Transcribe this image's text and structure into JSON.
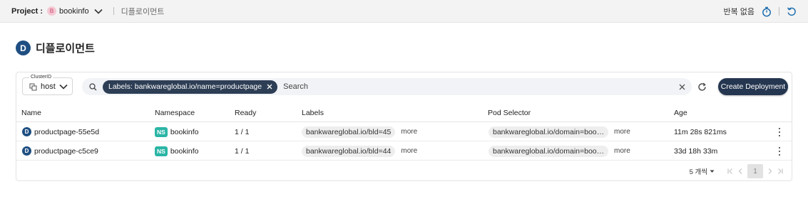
{
  "topbar": {
    "project_label": "Project :",
    "project_icon_letter": "B",
    "project_name": "bookinfo",
    "breadcrumb": "디플로이먼트",
    "repeat_label": "반복 없음"
  },
  "page": {
    "badge": "D",
    "title": "디플로이먼트"
  },
  "toolbar": {
    "cluster_label": "ClusterID",
    "cluster_value": "host",
    "filter_chip": "Labels: bankwareglobal.io/name=productpage",
    "search_placeholder": "Search",
    "create_label": "Create Deployment"
  },
  "table": {
    "columns": [
      "Name",
      "Namespace",
      "Ready",
      "Labels",
      "Pod Selector",
      "Age"
    ],
    "rows": [
      {
        "icon": "D",
        "name": "productpage-55e5d",
        "ns_badge": "NS",
        "namespace": "bookinfo",
        "ready": "1 / 1",
        "label": "bankwareglobal.io/bld=45",
        "label_more": "more",
        "selector": "bankwareglobal.io/domain=boo…",
        "selector_more": "more",
        "age": "11m 28s 821ms"
      },
      {
        "icon": "D",
        "name": "productpage-c5ce9",
        "ns_badge": "NS",
        "namespace": "bookinfo",
        "ready": "1 / 1",
        "label": "bankwareglobal.io/bld=44",
        "label_more": "more",
        "selector": "bankwareglobal.io/domain=boo…",
        "selector_more": "more",
        "age": "33d 18h 33m"
      }
    ]
  },
  "pagination": {
    "page_size": "5 개씩",
    "current_page": "1"
  },
  "icons": {
    "chevron": "chevron-down-icon",
    "timer": "stopwatch-icon",
    "undo": "undo-icon",
    "search": "search-icon",
    "refresh": "refresh-icon",
    "more": "more-vertical-icon"
  },
  "colors": {
    "primary": "#1f4f82",
    "button_dark": "#253650",
    "chip": "#2d3e55",
    "namespace_badge": "#2bb5a5",
    "project_icon": "#f4c9d4"
  }
}
